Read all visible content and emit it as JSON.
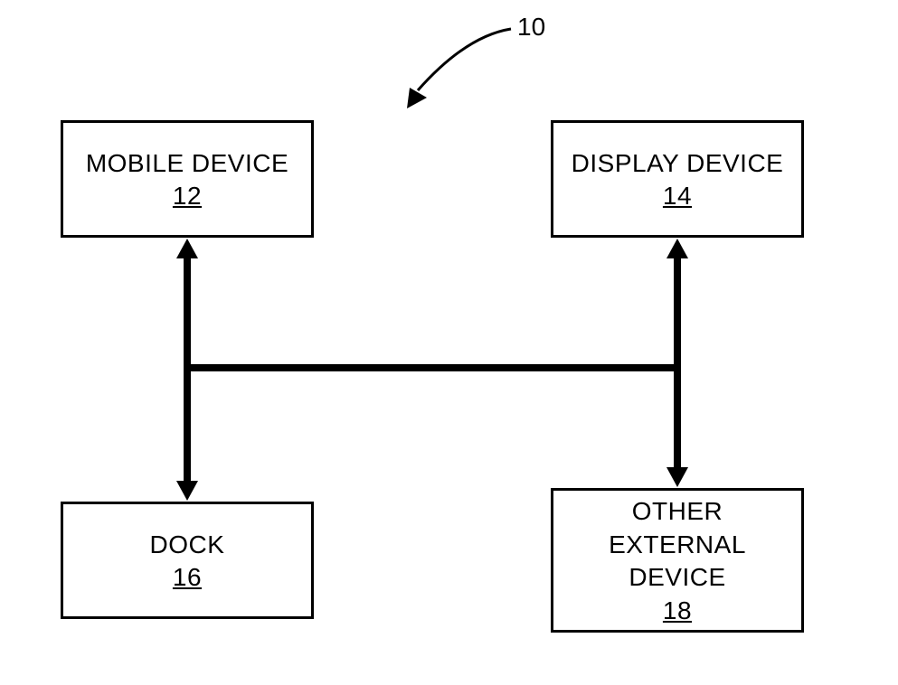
{
  "ref_label": "10",
  "boxes": {
    "top_left": {
      "label": "MOBILE DEVICE",
      "number": "12"
    },
    "top_right": {
      "label": "DISPLAY DEVICE",
      "number": "14"
    },
    "bottom_left": {
      "label": "DOCK",
      "number": "16"
    },
    "bottom_right": {
      "label": "OTHER EXTERNAL DEVICE",
      "number": "18"
    }
  }
}
